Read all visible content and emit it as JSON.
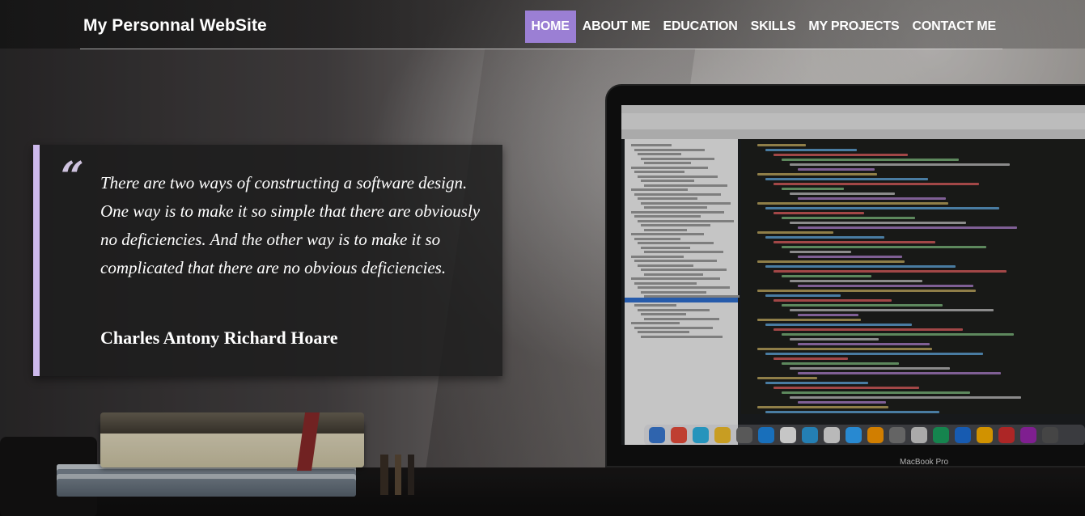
{
  "header": {
    "brand": "My Personnal WebSite",
    "nav": [
      {
        "label": "HOME",
        "active": true
      },
      {
        "label": "ABOUT ME",
        "active": false
      },
      {
        "label": "EDUCATION",
        "active": false
      },
      {
        "label": "SKILLS",
        "active": false
      },
      {
        "label": "MY PROJECTS",
        "active": false
      },
      {
        "label": "CONTACT ME",
        "active": false
      }
    ]
  },
  "hero": {
    "quote_mark": "“",
    "quote": "There are two ways of constructing a software design. One way is to make it so simple that there are obviously no deficiencies. And the other way is to make it so complicated that there are no obvious deficiencies.",
    "author": "Charles Antony Richard Hoare",
    "laptop_label": "MacBook Pro"
  },
  "colors": {
    "accent": "#9b7fd4",
    "quote_border": "#cdb9ec"
  }
}
